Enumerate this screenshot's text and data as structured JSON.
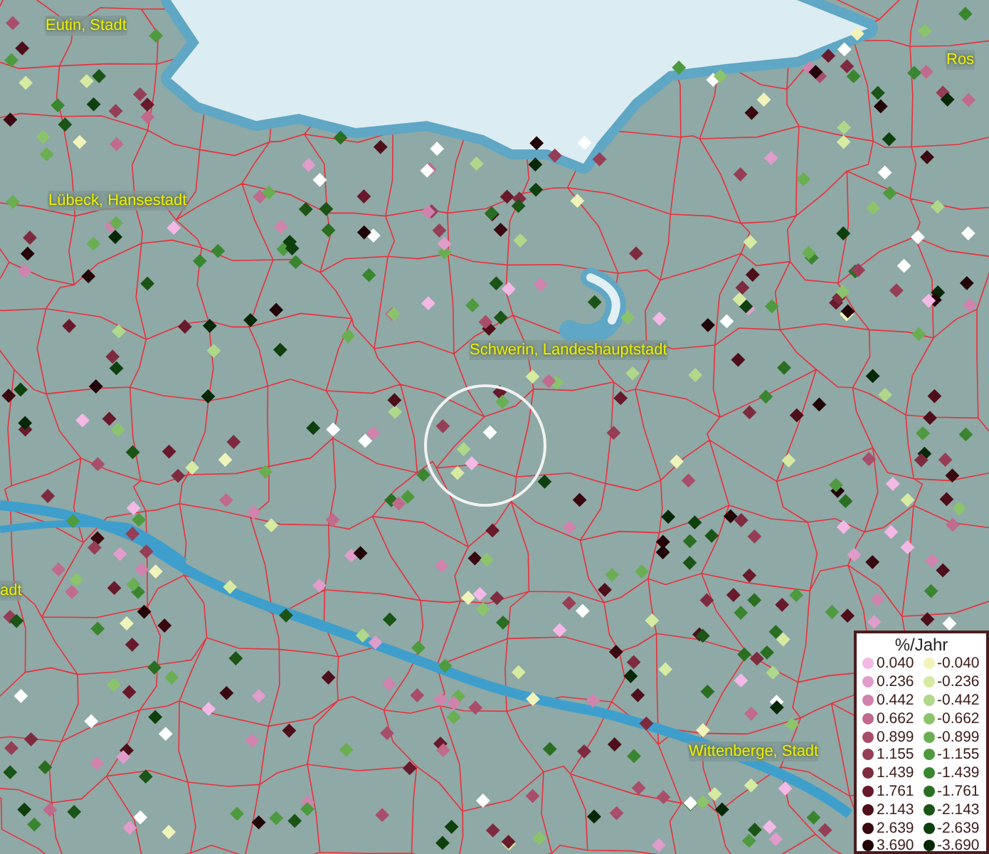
{
  "map": {
    "place_labels": [
      "Eutin, Stadt",
      "Ros",
      "Lübeck, Hansestadt",
      "Schwerin, Landeshauptstadt",
      "adt",
      "Wittenberge, Stadt"
    ]
  },
  "legend": {
    "title": "%/Jahr",
    "positive": [
      {
        "label": "0.040",
        "color": "#f4b8e6"
      },
      {
        "label": "0.236",
        "color": "#e09ccb"
      },
      {
        "label": "0.442",
        "color": "#d083ad"
      },
      {
        "label": "0.662",
        "color": "#c06a8c"
      },
      {
        "label": "0.899",
        "color": "#a94e6a"
      },
      {
        "label": "1.155",
        "color": "#963e56"
      },
      {
        "label": "1.439",
        "color": "#7e2b40"
      },
      {
        "label": "1.761",
        "color": "#681a2c"
      },
      {
        "label": "2.143",
        "color": "#4e0e1a"
      },
      {
        "label": "2.639",
        "color": "#3a0810"
      },
      {
        "label": "3.690",
        "color": "#220408"
      }
    ],
    "negative": [
      {
        "label": "-0.040",
        "color": "#f0f4ba"
      },
      {
        "label": "-0.236",
        "color": "#d6eaa2"
      },
      {
        "label": "-0.442",
        "color": "#b0d88a"
      },
      {
        "label": "-0.662",
        "color": "#8cc46c"
      },
      {
        "label": "-0.899",
        "color": "#6aae52"
      },
      {
        "label": "-1.155",
        "color": "#4e9a3e"
      },
      {
        "label": "-1.439",
        "color": "#3a8630"
      },
      {
        "label": "-1.761",
        "color": "#2a6e22"
      },
      {
        "label": "-2.143",
        "color": "#1a5416"
      },
      {
        "label": "-2.639",
        "color": "#0e400e"
      },
      {
        "label": "-3.690",
        "color": "#062806"
      }
    ]
  }
}
